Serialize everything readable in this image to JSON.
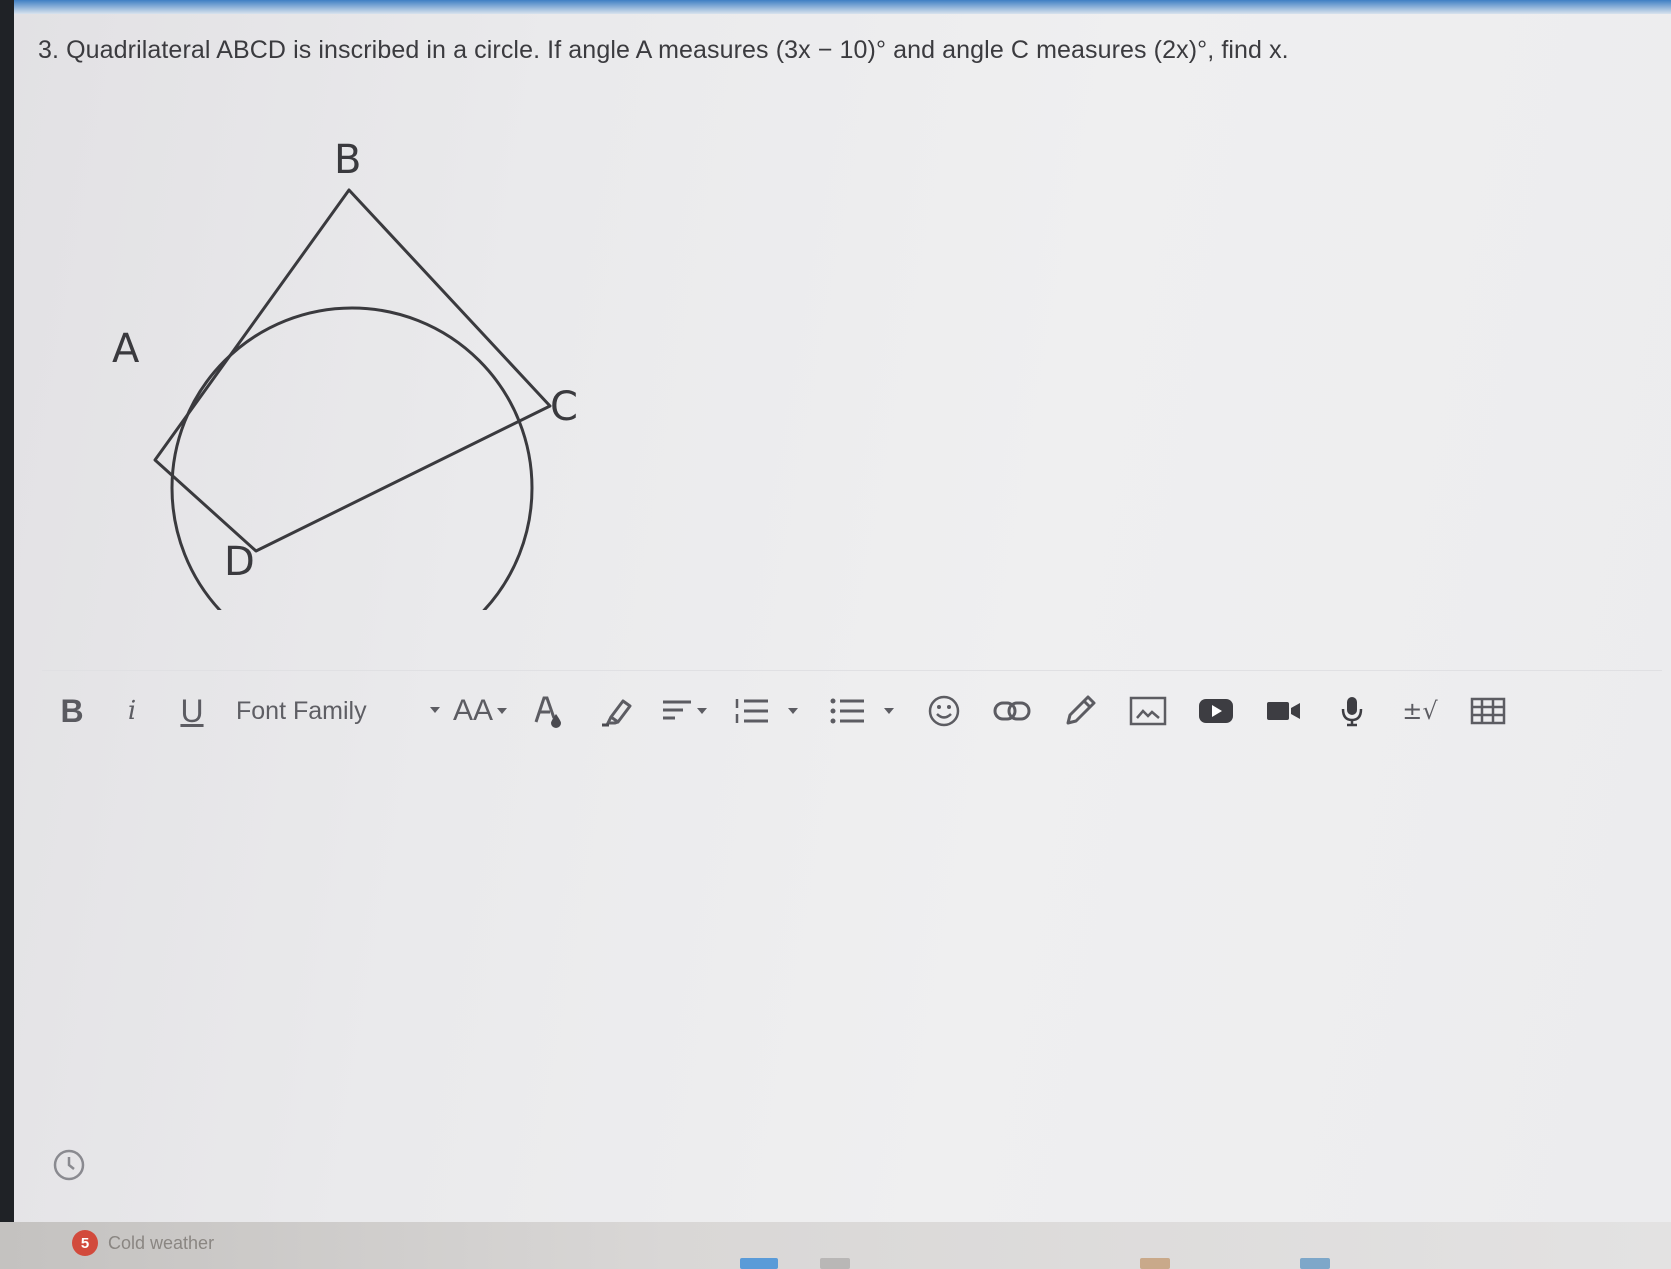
{
  "question": {
    "text": "3. Quadrilateral ABCD is inscribed in a circle. If angle A measures (3x − 10)° and angle C measures (2x)°, find x."
  },
  "figure": {
    "vertices": {
      "A": "A",
      "B": "B",
      "C": "C",
      "D": "D"
    }
  },
  "toolbar": {
    "bold_label": "B",
    "italic_label": "i",
    "underline_label": "U",
    "font_family_label": "Font Family",
    "font_size_label": "AA",
    "math_label": "±√",
    "icons": [
      "font-size-icon",
      "text-color-icon",
      "highlight-icon",
      "align-icon",
      "ordered-list-icon",
      "unordered-list-icon",
      "emoji-icon",
      "link-icon",
      "pencil-icon",
      "image-icon",
      "youtube-icon",
      "video-icon",
      "microphone-icon",
      "math-icon",
      "table-icon"
    ]
  },
  "taskbar": {
    "weather_badge": "5",
    "weather_text": "Cold weather"
  },
  "colors": {
    "text": "#3b3b3f",
    "toolbar_icon": "#5c5c62",
    "background": "#ececee",
    "accent_bar": "#3f7fc4"
  }
}
